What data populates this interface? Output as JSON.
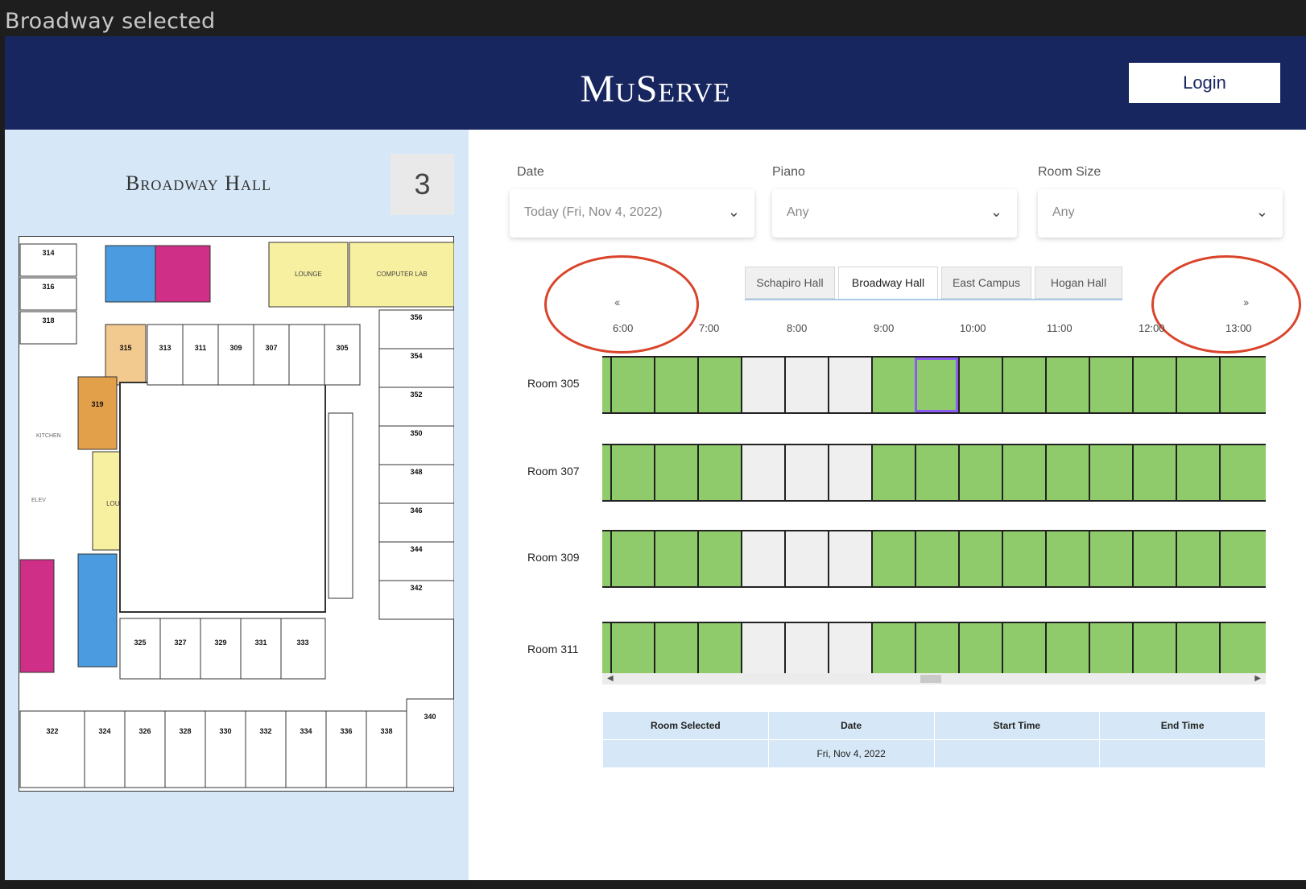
{
  "window": {
    "caption": "Broadway selected"
  },
  "header": {
    "brand": "MuServe",
    "login_label": "Login"
  },
  "left_panel": {
    "hall_title": "Broadway Hall",
    "floor_number": "3",
    "map_labels": {
      "lounge_top": "LOUNGE",
      "computer_lab": "COMPUTER LAB",
      "kitchen": "KITCHEN",
      "elev": "ELEV",
      "lounge_mid": "LOUNGE",
      "rooms": [
        "314",
        "316",
        "318",
        "356",
        "354",
        "352",
        "350",
        "348",
        "346",
        "344",
        "342",
        "340",
        "315",
        "313",
        "311",
        "309",
        "307",
        "305",
        "319",
        "325",
        "327",
        "329",
        "331",
        "333",
        "322",
        "324",
        "326",
        "328",
        "330",
        "332",
        "334",
        "336",
        "338"
      ]
    }
  },
  "filters": {
    "date": {
      "label": "Date",
      "value": "Today (Fri, Nov 4, 2022)"
    },
    "piano": {
      "label": "Piano",
      "value": "Any"
    },
    "room_size": {
      "label": "Room Size",
      "value": "Any"
    }
  },
  "hall_tabs": [
    {
      "label": "Schapiro Hall",
      "active": false
    },
    {
      "label": "Broadway Hall",
      "active": true
    },
    {
      "label": "East Campus",
      "active": false
    },
    {
      "label": "Hogan Hall",
      "active": false
    }
  ],
  "nav": {
    "prev": "‹‹",
    "next": "››"
  },
  "times": [
    "6:00",
    "7:00",
    "8:00",
    "9:00",
    "10:00",
    "11:00",
    "12:00",
    "13:00"
  ],
  "rooms": [
    {
      "label": "Room 305",
      "slots": [
        "free",
        "free",
        "free",
        "busy",
        "busy",
        "busy",
        "free",
        "sel",
        "free",
        "free",
        "free",
        "free",
        "free",
        "free",
        "free"
      ]
    },
    {
      "label": "Room 307",
      "slots": [
        "free",
        "free",
        "free",
        "busy",
        "busy",
        "busy",
        "free",
        "free",
        "free",
        "free",
        "free",
        "free",
        "free",
        "free",
        "free"
      ]
    },
    {
      "label": "Room 309",
      "slots": [
        "free",
        "free",
        "free",
        "busy",
        "busy",
        "busy",
        "free",
        "free",
        "free",
        "free",
        "free",
        "free",
        "free",
        "free",
        "free"
      ]
    },
    {
      "label": "Room 311",
      "slots": [
        "free",
        "free",
        "free",
        "busy",
        "busy",
        "busy",
        "free",
        "free",
        "free",
        "free",
        "free",
        "free",
        "free",
        "free",
        "free"
      ]
    }
  ],
  "summary": {
    "headers": [
      "Room Selected",
      "Date",
      "Start Time",
      "End Time"
    ],
    "values": [
      "",
      "Fri, Nov 4, 2022",
      "",
      ""
    ]
  },
  "colors": {
    "navy": "#182660",
    "free": "#8fca6b",
    "busy": "#efefef",
    "selected": "#8a5cf0",
    "annotation": "#d9442b"
  }
}
